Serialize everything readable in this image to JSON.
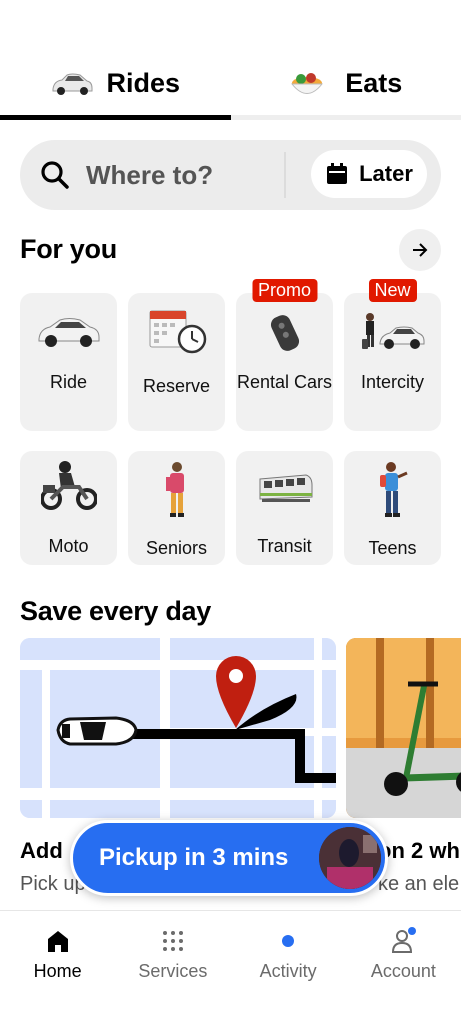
{
  "tabs": [
    {
      "label": "Rides",
      "icon": "car-icon",
      "active": true
    },
    {
      "label": "Eats",
      "icon": "food-bowl-icon",
      "active": false
    }
  ],
  "search": {
    "placeholder": "Where to?",
    "later_label": "Later"
  },
  "for_you": {
    "title": "For you",
    "row1": [
      {
        "label": "Ride",
        "icon": "car-icon"
      },
      {
        "label": "Reserve",
        "icon": "calendar-clock-icon"
      },
      {
        "label": "Rental Cars",
        "icon": "car-key-icon",
        "badge": "Promo"
      },
      {
        "label": "Intercity",
        "icon": "traveler-car-icon",
        "badge": "New"
      }
    ],
    "row2": [
      {
        "label": "Moto",
        "icon": "motorcycle-icon"
      },
      {
        "label": "Seniors",
        "icon": "senior-person-icon"
      },
      {
        "label": "Transit",
        "icon": "train-icon"
      },
      {
        "label": "Teens",
        "icon": "teen-person-icon"
      }
    ]
  },
  "save": {
    "title": "Save every day",
    "promo1_title": "Add",
    "promo1_sub": "Pick up",
    "promo2_title": "on 2 wh",
    "promo2_sub": "ke an ele"
  },
  "pickup": {
    "label": "Pickup in 3 mins"
  },
  "bottom_nav": [
    {
      "label": "Home",
      "icon": "home-icon",
      "active": true
    },
    {
      "label": "Services",
      "icon": "grid-dots-icon",
      "active": false
    },
    {
      "label": "Activity",
      "icon": "activity-dot-icon",
      "active": false
    },
    {
      "label": "Account",
      "icon": "person-icon",
      "active": false
    }
  ],
  "colors": {
    "accent_blue": "#276ef1",
    "badge_red": "#e11900",
    "tile_bg": "#f1f1f1"
  }
}
